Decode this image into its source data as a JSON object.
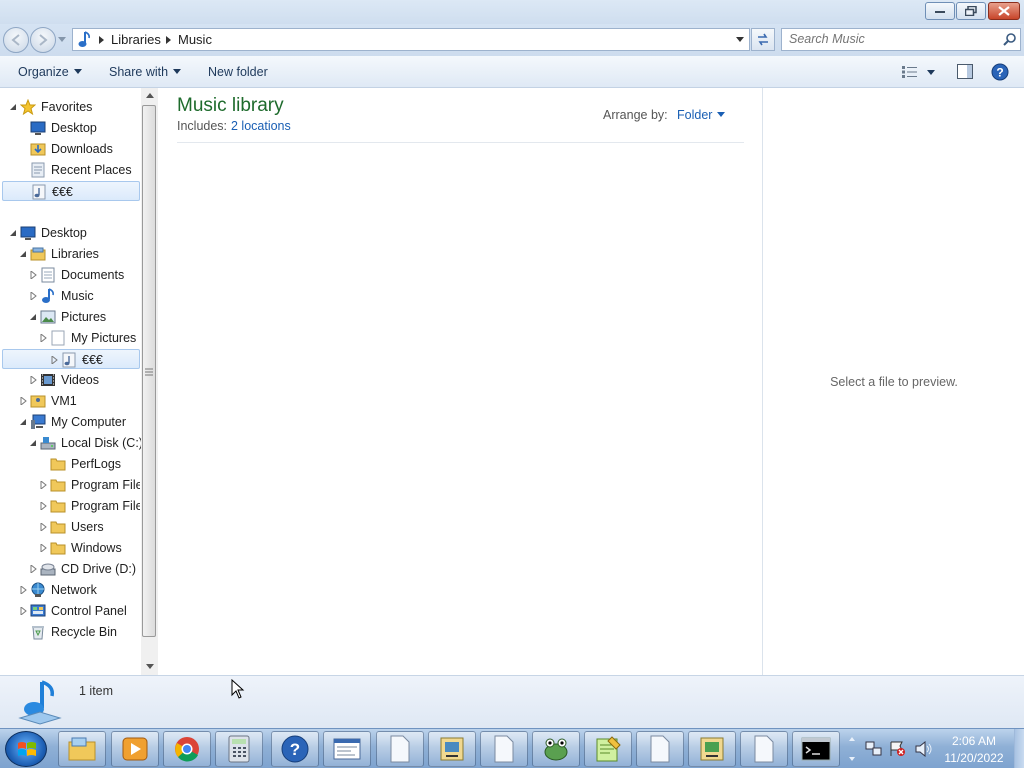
{
  "window": {
    "controls": {
      "minimize": "minimize",
      "maximize": "restore",
      "close": "close"
    }
  },
  "address": {
    "crumbs": [
      "Libraries",
      "Music"
    ],
    "search_placeholder": "Search Music"
  },
  "toolbar": {
    "organize": "Organize",
    "share_with": "Share with",
    "new_folder": "New folder"
  },
  "nav": {
    "favorites": {
      "label": "Favorites",
      "items": [
        "Desktop",
        "Downloads",
        "Recent Places",
        "€€€"
      ]
    },
    "desktop": "Desktop",
    "libraries": "Libraries",
    "documents": "Documents",
    "music": "Music",
    "pictures": "Pictures",
    "my_pictures": "My Pictures",
    "euro": "€€€",
    "videos": "Videos",
    "vm1": "VM1",
    "my_computer": "My Computer",
    "local_disk": "Local Disk (C:)",
    "perflogs": "PerfLogs",
    "program_files_1": "Program Files",
    "program_files_2": "Program Files",
    "users": "Users",
    "windows": "Windows",
    "cd_drive": "CD Drive (D:)",
    "network": "Network",
    "control_panel": "Control Panel",
    "recycle_bin": "Recycle Bin"
  },
  "library": {
    "title": "Music library",
    "includes_label": "Includes:",
    "locations_link": "2 locations",
    "arrange_label": "Arrange by:",
    "arrange_value": "Folder"
  },
  "preview": {
    "message": "Select a file to preview."
  },
  "details": {
    "count": "1 item"
  },
  "taskbar": {
    "apps": [
      "windows-explorer",
      "media-player",
      "chrome",
      "calculator",
      "help",
      "wordpad",
      "blank-file-1",
      "control-panel-app",
      "blank-file-2",
      "frog-app",
      "notepad-plus-plus",
      "blank-file-3",
      "gallery-app",
      "blank-file-4",
      "command-prompt"
    ],
    "clock": {
      "time": "2:06 AM",
      "date": "11/20/2022"
    }
  },
  "colors": {
    "library_title": "#1e6b2c",
    "link": "#1a5fb4",
    "selection_border": "#a8c8ed",
    "taskbar": "#8fb0d6"
  }
}
